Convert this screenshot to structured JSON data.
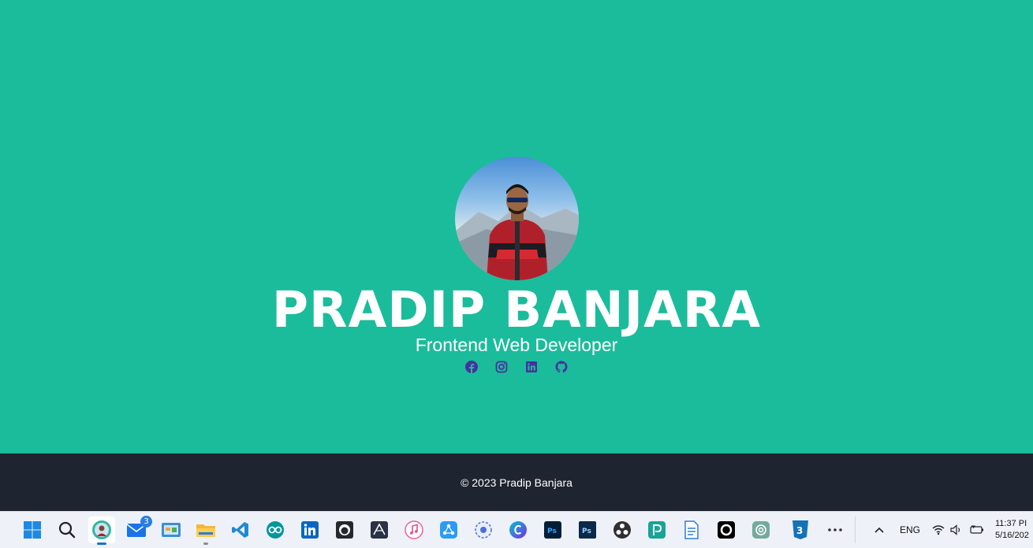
{
  "hero": {
    "name": "PRADIP BANJARA",
    "role": "Frontend Web Developer",
    "socials": [
      {
        "icon": "facebook-icon"
      },
      {
        "icon": "instagram-icon"
      },
      {
        "icon": "linkedin-icon"
      },
      {
        "icon": "github-icon"
      }
    ],
    "social_color": "#4a2fa0"
  },
  "footer": {
    "copyright": "© 2023 Pradip Banjara"
  },
  "taskbar": {
    "apps": [
      {
        "icon": "windows-start-icon"
      },
      {
        "icon": "search-icon"
      },
      {
        "icon": "browser-profile-icon"
      },
      {
        "icon": "mail-icon",
        "badge": "3"
      },
      {
        "icon": "control-panel-icon"
      },
      {
        "icon": "file-explorer-icon"
      },
      {
        "icon": "vscode-icon"
      },
      {
        "icon": "arduino-icon"
      },
      {
        "icon": "linkedin-app-icon"
      },
      {
        "icon": "github-desktop-icon"
      },
      {
        "icon": "app-icon"
      },
      {
        "icon": "itunes-icon"
      },
      {
        "icon": "sync-app-icon"
      },
      {
        "icon": "settings-app-icon"
      },
      {
        "icon": "canva-icon"
      },
      {
        "icon": "photoshop-icon"
      },
      {
        "icon": "photoshop-classic-icon"
      },
      {
        "icon": "obs-icon"
      },
      {
        "icon": "photopea-icon"
      },
      {
        "icon": "document-icon"
      },
      {
        "icon": "app-o-icon"
      },
      {
        "icon": "chatgpt-icon"
      },
      {
        "icon": "css3-icon"
      },
      {
        "icon": "more-icon"
      }
    ],
    "language": "ENG",
    "time": "11:37 PI",
    "date": "5/16/202"
  }
}
